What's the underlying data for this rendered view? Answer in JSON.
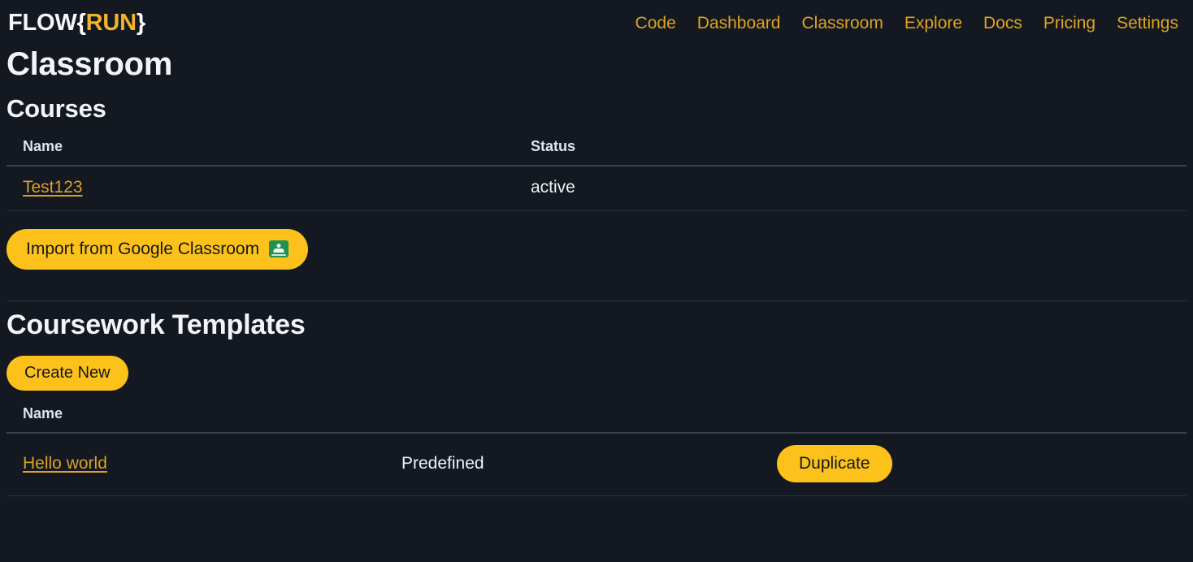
{
  "header": {
    "logo": {
      "flow": "FLOW",
      "brace_open": "{",
      "run": "RUN",
      "brace_close": "}"
    },
    "nav": [
      {
        "label": "Code"
      },
      {
        "label": "Dashboard"
      },
      {
        "label": "Classroom"
      },
      {
        "label": "Explore"
      },
      {
        "label": "Docs"
      },
      {
        "label": "Pricing"
      },
      {
        "label": "Settings"
      }
    ]
  },
  "page": {
    "title": "Classroom"
  },
  "courses": {
    "heading": "Courses",
    "columns": {
      "name": "Name",
      "status": "Status"
    },
    "rows": [
      {
        "name": "Test123",
        "status": "active"
      }
    ],
    "import_button": {
      "label": "Import from Google Classroom",
      "icon": "google-classroom-icon"
    }
  },
  "templates": {
    "heading": "Coursework Templates",
    "create_button": {
      "label": "Create New"
    },
    "columns": {
      "name": "Name"
    },
    "rows": [
      {
        "name": "Hello world",
        "kind": "Predefined",
        "action": "Duplicate"
      }
    ]
  },
  "colors": {
    "background": "#141821",
    "accent_yellow": "#fcc21b",
    "link_amber": "#d9a227",
    "nav_amber": "#dda520",
    "text_primary": "#eef2f6",
    "divider": "#2c323e",
    "google_classroom_green": "#1e9153"
  }
}
